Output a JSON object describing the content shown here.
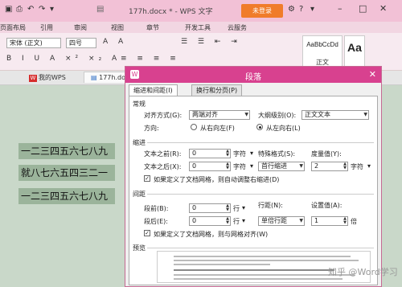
{
  "titlebar": {
    "doc_title": "177h.docx * - WPS 文字",
    "login_label": "未登录",
    "color": "#f2c1d6"
  },
  "ribbon_tabs": [
    "页面布局",
    "引用",
    "审阅",
    "视图",
    "章节",
    "开发工具",
    "云服务"
  ],
  "ribbon": {
    "font_name": "宋体 (正文)",
    "font_size": "四号",
    "styles": [
      {
        "sample": "AaBbCcDd",
        "label": "正文"
      },
      {
        "sample": "Aa",
        "label": ""
      }
    ]
  },
  "doc_tabs": {
    "my_wps": "我的WPS",
    "file": "177h.doc"
  },
  "document": {
    "lines": [
      "一二三四五六七八九",
      "就八七六五四三二一",
      "一二三四五六七八九"
    ]
  },
  "dialog": {
    "title": "段落",
    "tabs": [
      "缩进和间距(I)",
      "换行和分页(P)"
    ],
    "general": {
      "heading": "常规",
      "align_label": "对齐方式(G):",
      "align_value": "两端对齐",
      "outline_label": "大纲级别(O):",
      "outline_value": "正文文本",
      "direction_label": "方向:",
      "rtl_label": "从右向左(F)",
      "ltr_label": "从左向右(L)"
    },
    "indent": {
      "heading": "缩进",
      "before_label": "文本之前(R):",
      "before_value": "0",
      "before_unit": "字符",
      "after_label": "文本之后(X):",
      "after_value": "0",
      "after_unit": "字符",
      "special_label": "特殊格式(S):",
      "special_value": "首行缩进",
      "degree_label": "度量值(Y):",
      "degree_value": "2",
      "degree_unit": "字符",
      "grid_check": "如果定义了文档网格，则自动调整右缩进(D)"
    },
    "spacing": {
      "heading": "间距",
      "before_label": "段前(B):",
      "before_value": "0",
      "before_unit": "行",
      "after_label": "段后(E):",
      "after_value": "0",
      "after_unit": "行",
      "line_label": "行距(N):",
      "line_value": "单倍行距",
      "set_label": "设置值(A):",
      "set_value": "1",
      "set_unit": "倍",
      "grid_check": "如果定义了文档网格，则与网格对齐(W)"
    },
    "preview": {
      "heading": "预览"
    }
  },
  "watermark": "知乎 @Word学习",
  "colors": {
    "accent": "#d8418f",
    "login": "#f07c2a",
    "highlight": "#9bb49b",
    "page_bg": "#c9d8c9"
  }
}
